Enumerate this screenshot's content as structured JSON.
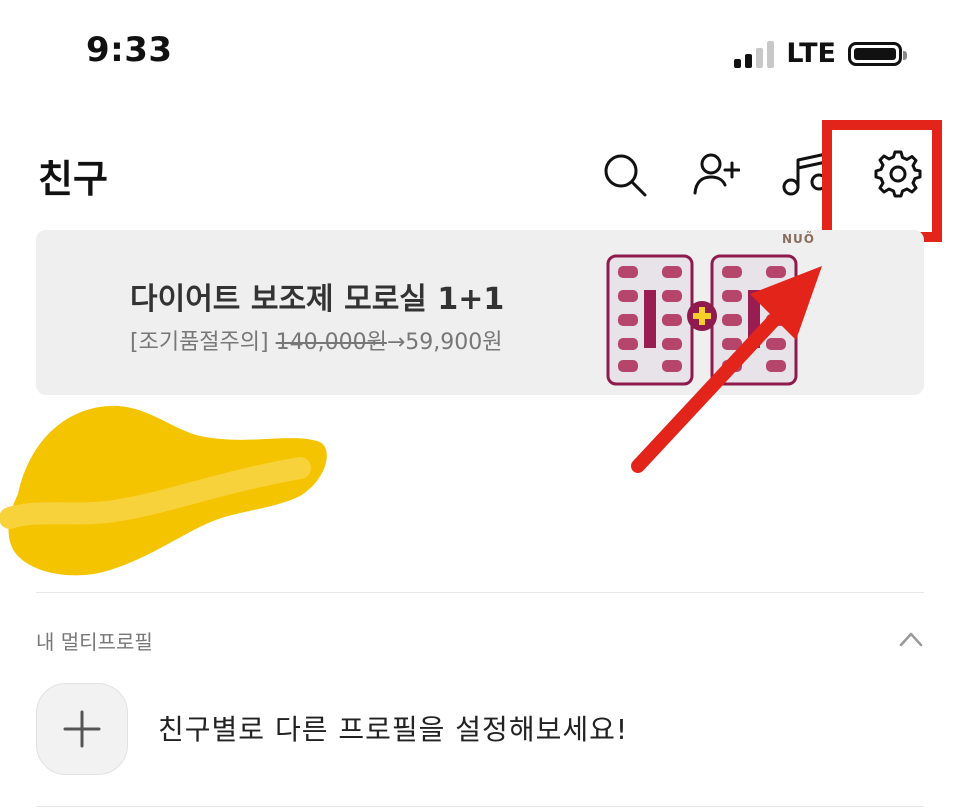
{
  "status_bar": {
    "time": "9:33",
    "network": "LTE",
    "signal_bars_active": 2,
    "signal_bars_total": 4,
    "battery_level": 1.0
  },
  "header": {
    "title": "친구",
    "icons": [
      "search-icon",
      "add-friend-icon",
      "music-icon",
      "settings-icon"
    ]
  },
  "banner": {
    "title": "다이어트 보조제 모로실 1+1",
    "desc_prefix": "[조기품절주의] ",
    "old_price": "140,000원",
    "arrow": "→",
    "new_price": "59,900원",
    "brand": "NUÕ"
  },
  "multi_profile": {
    "section_title": "내 멀티프로필",
    "add_label": "친구별로 다른 프로필을 설정해보세요!"
  },
  "colors": {
    "highlight": "#e3241b",
    "banner_bg": "#efefef",
    "scribble": "#f5c400"
  }
}
